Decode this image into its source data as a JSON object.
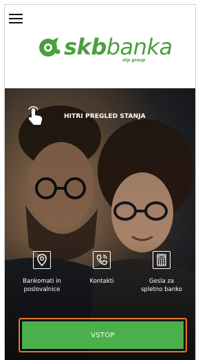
{
  "brand": {
    "name_bold": "skb",
    "name_light": "banka",
    "tagline": "otp group",
    "color": "#4aa03c"
  },
  "menu": {
    "icon": "hamburger-menu-icon"
  },
  "quick_balance": {
    "label": "HITRI PREGLED STANJA",
    "icon": "touch-hand-icon"
  },
  "tiles": [
    {
      "line1": "Bankomati in",
      "line2": "poslovalnice",
      "icon": "location-pin-icon"
    },
    {
      "line1": "Kontakti",
      "line2": "",
      "icon": "phone-icon"
    },
    {
      "line1": "Gesla za",
      "line2": "spletno banko",
      "icon": "calculator-icon"
    }
  ],
  "login": {
    "label": "VSTOP",
    "color": "#4ab04a",
    "highlight": "#e8762f"
  }
}
